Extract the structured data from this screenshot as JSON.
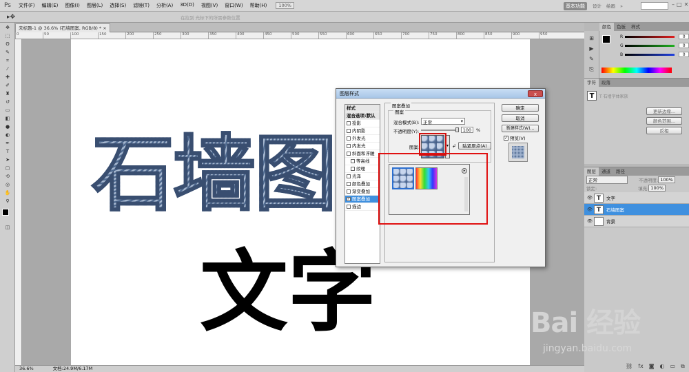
{
  "app": {
    "logo": "Ps"
  },
  "menu": [
    "文件(F)",
    "编辑(E)",
    "图像(I)",
    "图层(L)",
    "选择(S)",
    "滤镜(T)",
    "分析(A)",
    "3D(D)",
    "视图(V)",
    "窗口(W)",
    "帮助(H)"
  ],
  "menu_extras": [
    "100%"
  ],
  "workspace": {
    "label": "基本功能",
    "others": [
      "设计",
      "绘画",
      "»"
    ]
  },
  "options_bar": {
    "placeholder": "在拉到 光标下的所需参数位置"
  },
  "document": {
    "tab": "未标题-1 @ 36.6% (石墙图案, RGB/8) *",
    "zoom": "36.6%",
    "doc_info": "文档:24.9M/6.17M"
  },
  "ruler_ticks": [
    "0",
    "50",
    "100",
    "150",
    "200",
    "250",
    "300",
    "350",
    "400",
    "450",
    "500",
    "550",
    "600",
    "650",
    "700",
    "750",
    "800",
    "850",
    "900",
    "950"
  ],
  "canvas_text": {
    "stone": "石墙图",
    "black": "文字"
  },
  "panels": {
    "color_tabs": [
      "颜色",
      "色板",
      "样式"
    ],
    "channels": [
      {
        "label": "R",
        "value": "0",
        "color": "#e02020"
      },
      {
        "label": "G",
        "value": "0",
        "color": "#20b020"
      },
      {
        "label": "B",
        "value": "0",
        "color": "#2040e0"
      }
    ],
    "char_tabs": [
      "字符",
      "段落"
    ],
    "char_font": "T 石墙字体家族",
    "char_buttons": [
      "更新边缘...",
      "颜色范围...",
      "反相"
    ],
    "layers_tabs": [
      "图层",
      "通道",
      "路径"
    ],
    "blend_mode": "正常",
    "opacity_label": "不透明度:",
    "opacity_value": "100%",
    "fill_label": "填充:",
    "fill_value": "100%",
    "lock_label": "锁定:",
    "layers": [
      {
        "name": "文字",
        "selected": false
      },
      {
        "name": "石墙图案",
        "selected": true
      },
      {
        "name": "背景",
        "selected": false
      }
    ]
  },
  "dialog": {
    "title": "图层样式",
    "close": "x",
    "styles_header": "样式",
    "styles": [
      {
        "label": "混合选项:默认",
        "check": false,
        "header": true
      },
      {
        "label": "投影",
        "check": true
      },
      {
        "label": "内阴影",
        "check": true
      },
      {
        "label": "外发光",
        "check": true
      },
      {
        "label": "内发光",
        "check": true
      },
      {
        "label": "斜面和浮雕",
        "check": true
      },
      {
        "label": "等高线",
        "check": true,
        "indent": true
      },
      {
        "label": "纹理",
        "check": true,
        "indent": true
      },
      {
        "label": "光泽",
        "check": true
      },
      {
        "label": "颜色叠加",
        "check": true
      },
      {
        "label": "渐变叠加",
        "check": true
      },
      {
        "label": "图案叠加",
        "check": true,
        "selected": true
      },
      {
        "label": "描边",
        "check": true
      }
    ],
    "group_title": "图案叠加",
    "subgroup": "图案",
    "blend_label": "混合模式(B):",
    "blend_value": "正常",
    "opacity_label": "不透明度(Y):",
    "opacity_value": "100",
    "opacity_unit": "%",
    "pattern_label": "图案:",
    "snap_button": "贴紧原点(A)",
    "buttons": {
      "ok": "确定",
      "cancel": "取消",
      "new_style": "新建样式(W)...",
      "preview": "预览(V)"
    }
  },
  "watermark": {
    "logo": "Bai 经验",
    "url": "jingyan.baidu.com"
  }
}
